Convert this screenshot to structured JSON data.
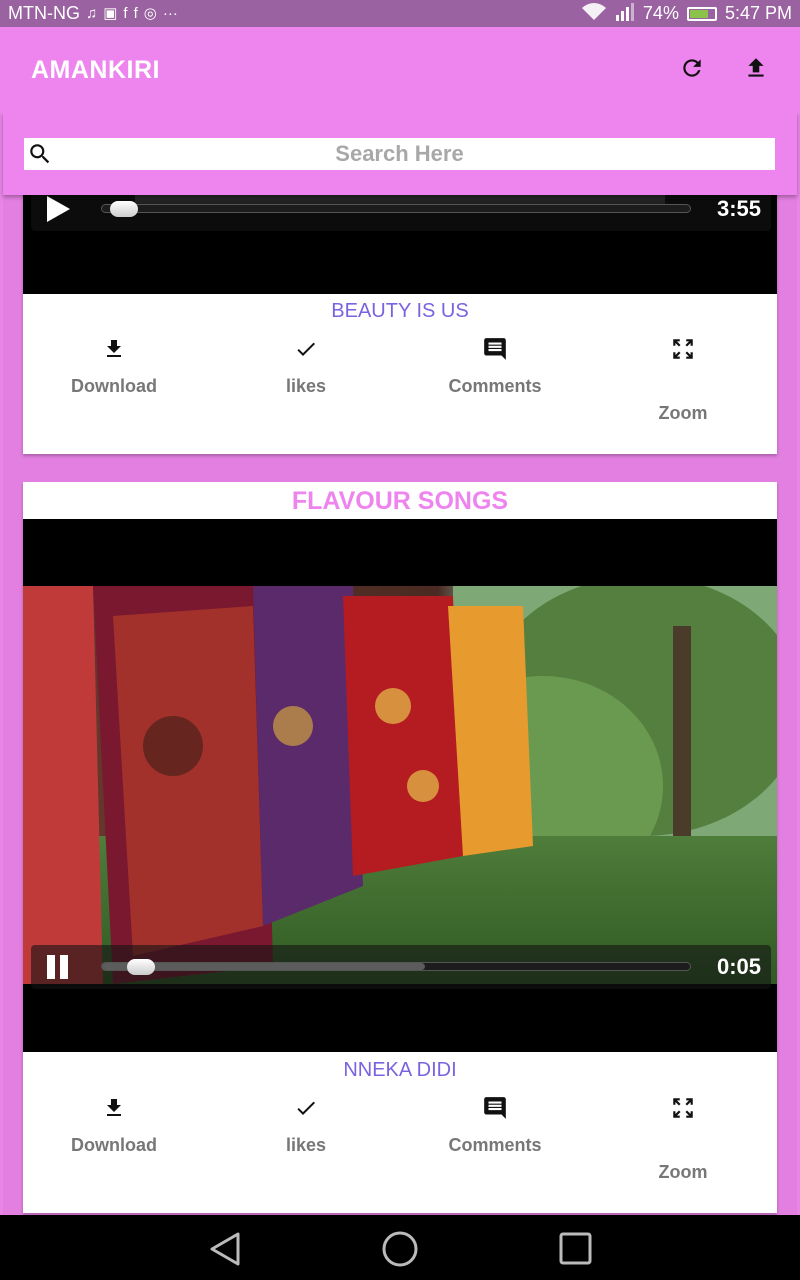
{
  "status_bar": {
    "carrier": "MTN-NG",
    "notification_icons": [
      "music-icon",
      "android-icon",
      "facebook-icon",
      "facebook-icon",
      "whatsapp-icon",
      "more-icon"
    ],
    "battery_percent": "74%",
    "time": "5:47 PM"
  },
  "app_bar": {
    "title": "AMANKIRI",
    "actions": [
      "refresh-icon",
      "upload-icon"
    ]
  },
  "search": {
    "placeholder": "Search Here"
  },
  "colors": {
    "accent_pink": "#ee84ee",
    "song_name": "#7b63e0",
    "action_label": "#777777"
  },
  "cards": [
    {
      "video": {
        "state": "paused",
        "time": "3:55",
        "progress_fraction": 0.02,
        "buffered_fraction": 0.0
      },
      "song_name": "BEAUTY IS US",
      "actions": {
        "download": "Download",
        "likes": "likes",
        "comments": "Comments",
        "zoom": "Zoom"
      }
    },
    {
      "title": "FLAVOUR SONGS",
      "video": {
        "state": "playing",
        "time": "0:05",
        "progress_fraction": 0.05,
        "buffered_fraction": 0.55
      },
      "song_name": "NNEKA DIDI",
      "actions": {
        "download": "Download",
        "likes": "likes",
        "comments": "Comments",
        "zoom": "Zoom"
      }
    }
  ],
  "nav_bar": [
    "back-icon",
    "home-icon",
    "recents-icon"
  ]
}
